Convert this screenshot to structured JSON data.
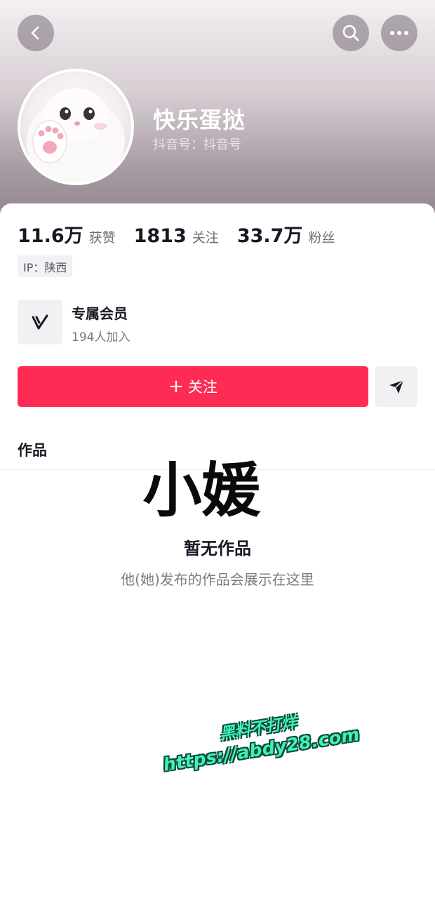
{
  "header": {
    "back_icon": "chevron-left-icon",
    "search_icon": "search-icon",
    "more_icon": "more-horizontal-icon"
  },
  "profile": {
    "name": "快乐蛋挞",
    "id_text": "抖音号：抖音号",
    "avatar": "kitten-avatar"
  },
  "stats": [
    {
      "value": "11.6万",
      "label": "获赞"
    },
    {
      "value": "1813",
      "label": "关注"
    },
    {
      "value": "33.7万",
      "label": "粉丝"
    }
  ],
  "ip": "IP：陕西",
  "membership": {
    "icon": "v-logo-icon",
    "title": "专属会员",
    "subtitle": "194人加入"
  },
  "actions": {
    "follow_plus": "+",
    "follow_label": "关注",
    "share_icon": "send-icon"
  },
  "tabs": [
    {
      "label": "作品"
    }
  ],
  "overlay_text": "小媛",
  "empty_state": {
    "title": "暂无作品",
    "subtitle": "他(她)发布的作品会展示在这里"
  },
  "watermark": {
    "line1": "黑料不打烊",
    "line2": "https://abdy28.com"
  },
  "colors": {
    "follow_button": "#fe2c55",
    "watermark": "#3ef2b8"
  }
}
